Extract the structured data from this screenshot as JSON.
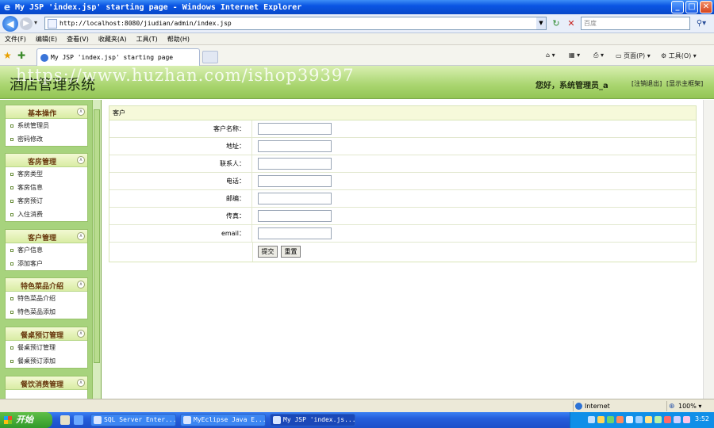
{
  "window": {
    "title": "My JSP 'index.jsp' starting page - Windows Internet Explorer",
    "min_label": "_",
    "max_label": "□",
    "close_label": "✕"
  },
  "browser": {
    "url": "http://localhost:8080/jiudian/admin/index.jsp",
    "search_placeholder": "百度",
    "menu": [
      "文件(F)",
      "编辑(E)",
      "查看(V)",
      "收藏夹(A)",
      "工具(T)",
      "帮助(H)"
    ],
    "tab_label": "My JSP 'index.jsp' starting page",
    "cmd_page": "页面(P)",
    "cmd_tools": "工具(O)"
  },
  "app": {
    "title": "酒店管理系统",
    "watermark": "https://www.huzhan.com/ishop39397",
    "greeting": "您好，系统管理员_a",
    "logout_link": "[注销退出]",
    "home_link": "[显示主框架]"
  },
  "sidebar": {
    "groups": [
      {
        "title": "基本操作",
        "items": [
          "系统管理员",
          "密码修改"
        ]
      },
      {
        "title": "客房管理",
        "items": [
          "客房类型",
          "客房信息",
          "客房预订",
          "入住消费"
        ]
      },
      {
        "title": "客户管理",
        "items": [
          "客户信息",
          "添加客户"
        ]
      },
      {
        "title": "特色菜品介绍",
        "items": [
          "特色菜品介绍",
          "特色菜品添加"
        ]
      },
      {
        "title": "餐桌预订管理",
        "items": [
          "餐桌预订管理",
          "餐桌预订添加"
        ]
      },
      {
        "title": "餐饮消费管理",
        "items": []
      }
    ]
  },
  "form": {
    "panel_title": "客户",
    "fields": [
      {
        "label": "客户名称：",
        "value": ""
      },
      {
        "label": "地址：",
        "value": ""
      },
      {
        "label": "联系人：",
        "value": ""
      },
      {
        "label": "电话：",
        "value": ""
      },
      {
        "label": "邮编：",
        "value": ""
      },
      {
        "label": "传真：",
        "value": ""
      },
      {
        "label": "email：",
        "value": ""
      }
    ],
    "submit_label": "提交",
    "reset_label": "重置"
  },
  "status": {
    "zone": "Internet",
    "zoom": "100%"
  },
  "taskbar": {
    "start_label": "开始",
    "tasks": [
      "SQL Server Enter...",
      "MyEclipse Java E...",
      "My JSP 'index.js..."
    ],
    "clock": "3:52"
  }
}
